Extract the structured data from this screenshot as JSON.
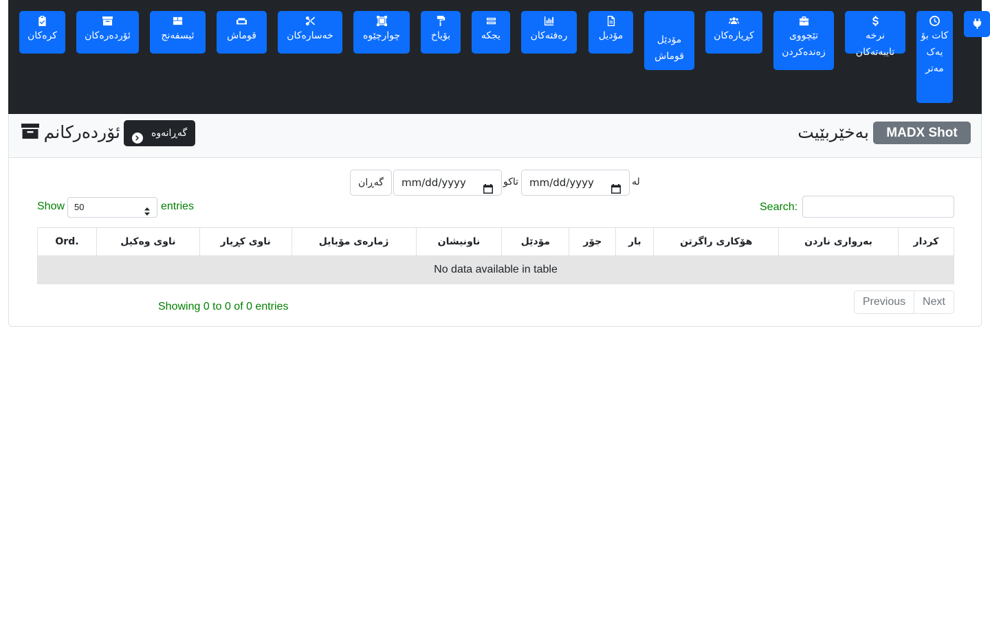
{
  "nav": {
    "plug_icon": "plug-icon",
    "items": [
      {
        "id": "kat",
        "label": "کات بۆ یەک مەتر",
        "icon": "clock-icon"
      },
      {
        "id": "rates",
        "label": "نرخە تایبەتەکان",
        "icon": "dollar-icon"
      },
      {
        "id": "test",
        "label": "تێچووی زەندەکردن",
        "icon": "toolbox-icon"
      },
      {
        "id": "customers",
        "label": "کڕیارەکان",
        "icon": "users-icon"
      },
      {
        "id": "fabric_model",
        "label": "مۆدێل قوماش",
        "icon": "file-icon"
      },
      {
        "id": "model",
        "label": "مۆدیل",
        "icon": "file-icon"
      },
      {
        "id": "weekly",
        "label": "رەفتەکان",
        "icon": "chart-icon"
      },
      {
        "id": "parts",
        "label": "یجکە",
        "icon": "layers-icon"
      },
      {
        "id": "paint",
        "label": "بۆیاخ",
        "icon": "paint-roller-icon"
      },
      {
        "id": "square",
        "label": "چوارچێوە",
        "icon": "frame-icon"
      },
      {
        "id": "loss",
        "label": "خەسارەکان",
        "icon": "scissors-icon"
      },
      {
        "id": "fabric",
        "label": "قوماش",
        "icon": "sofa-icon"
      },
      {
        "id": "sponge",
        "label": "ئیسفەنج",
        "icon": "box-icon"
      },
      {
        "id": "orders",
        "label": "ئۆردەرەکان",
        "icon": "archive-icon"
      },
      {
        "id": "works",
        "label": "کرەکان",
        "icon": "clipboard-check-icon"
      }
    ]
  },
  "header": {
    "brand": "MADX Shot",
    "welcome": "بەخێربێیت",
    "page_title": "ئۆردەرکانم",
    "back_label": "گەڕانەوە"
  },
  "filter": {
    "from_label": "لە",
    "to_label": "تاکو",
    "from_placeholder": "mm/dd/yyyy",
    "to_placeholder": "mm/dd/yyyy",
    "search_button": "گەڕان"
  },
  "table_controls": {
    "show_label": "Show",
    "entries_value": "50",
    "entries_label": "entries",
    "search_label": "Search:"
  },
  "table": {
    "columns": [
      "Ord.",
      "ناوی وەکیل",
      "ناوی کڕیار",
      "ژمارەی مۆبایل",
      "ناونیشان",
      "مۆدێل",
      "جۆر",
      "بار",
      "هۆکاری راگرتن",
      "بەرواری ناردن",
      "کردار"
    ],
    "empty_message": "No data available in table"
  },
  "footer": {
    "info": "Showing 0 to 0 of 0 entries",
    "previous": "Previous",
    "next": "Next"
  },
  "colors": {
    "primary": "#0d6efd",
    "dark": "#212529",
    "secondary": "#6c757d",
    "green_text": "#008000"
  }
}
